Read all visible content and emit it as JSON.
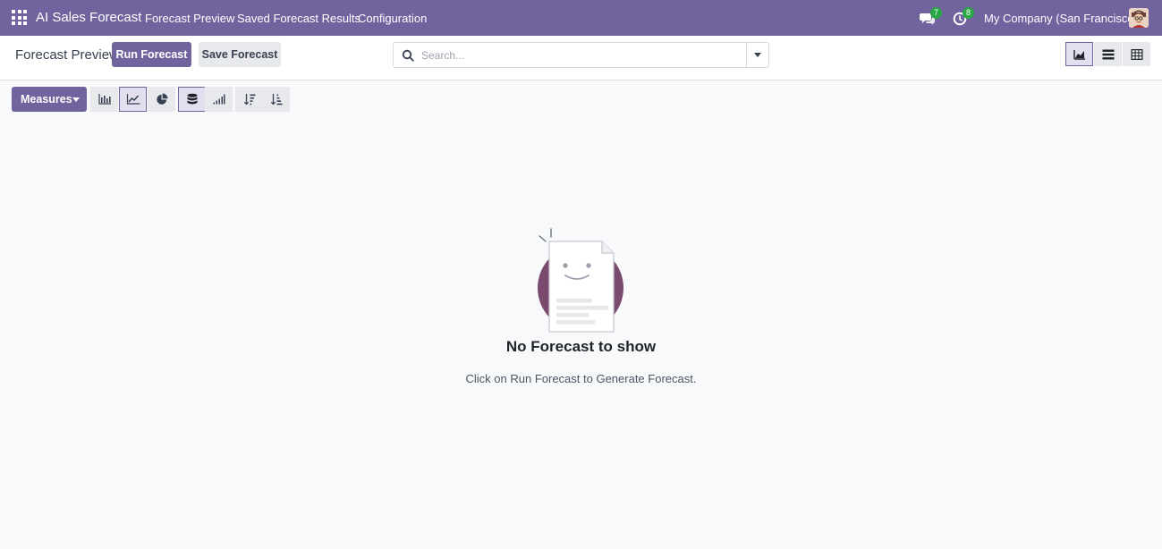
{
  "navbar": {
    "app_title": "AI Sales Forecast",
    "menus": [
      "Forecast Preview",
      "Saved Forecast Results",
      "Configuration"
    ],
    "messages_count": "7",
    "activities_count": "8",
    "company": "My Company (San Francisco)",
    "icons": [
      "apps-grid-icon",
      "chat-icon",
      "clock-icon",
      "avatar"
    ]
  },
  "control_panel": {
    "breadcrumb": "Forecast Preview",
    "run_label": "Run Forecast",
    "save_label": "Save Forecast",
    "search_placeholder": "Search...",
    "views": [
      "graph-view",
      "list-view",
      "pivot-view"
    ],
    "active_view": "graph-view"
  },
  "toolbar": {
    "measures_label": "Measures",
    "buttons": [
      "bar-chart",
      "line-chart",
      "pie-chart",
      "stacked",
      "cumulative",
      "descending",
      "ascending"
    ],
    "active": [
      "line-chart",
      "stacked"
    ]
  },
  "empty_state": {
    "title": "No Forecast to show",
    "body": "Click on Run Forecast to Generate Forecast."
  },
  "colors": {
    "brand": "#71639e",
    "badge": "#28a745",
    "background": "#f8f9fb",
    "illustration_circle": "#7a4a6e"
  }
}
